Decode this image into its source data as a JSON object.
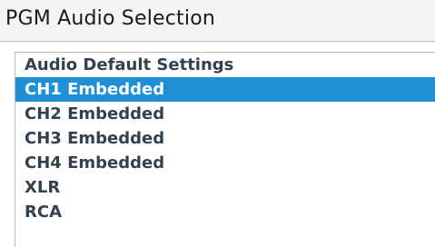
{
  "header": {
    "title": "PGM Audio Selection"
  },
  "menu": {
    "selected_index": 1,
    "items": [
      {
        "label": "Audio Default Settings"
      },
      {
        "label": "CH1 Embedded"
      },
      {
        "label": "CH2 Embedded"
      },
      {
        "label": "CH3 Embedded"
      },
      {
        "label": "CH4 Embedded"
      },
      {
        "label": "XLR"
      },
      {
        "label": "RCA"
      }
    ]
  },
  "colors": {
    "header_background": "#f4f4f4",
    "selected_background": "#1f8fd6",
    "item_text": "#33414f",
    "selected_text": "#ffffff"
  }
}
